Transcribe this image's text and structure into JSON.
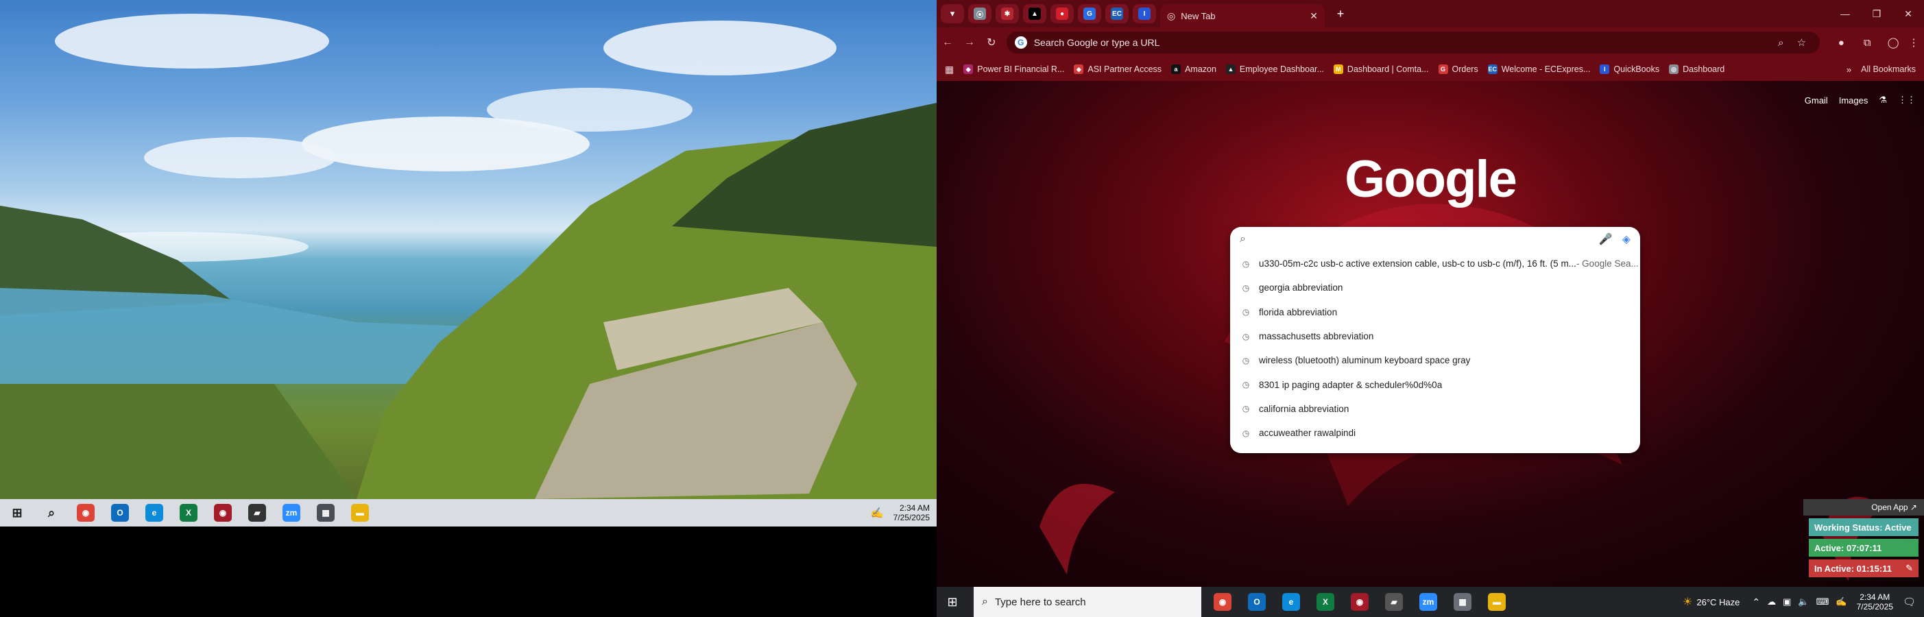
{
  "left": {
    "taskbar": {
      "apps": [
        {
          "name": "start",
          "glyph": "⊞",
          "color": "#1f1f1f"
        },
        {
          "name": "search",
          "glyph": "⌕",
          "color": "#1f1f1f"
        },
        {
          "name": "chrome",
          "glyph": "◉",
          "color": "#db4437"
        },
        {
          "name": "outlook",
          "glyph": "O",
          "color": "#0f6cbd"
        },
        {
          "name": "edge",
          "glyph": "e",
          "color": "#0c8cd8"
        },
        {
          "name": "excel",
          "glyph": "X",
          "color": "#107c41"
        },
        {
          "name": "chrome-profile",
          "glyph": "◉",
          "color": "#a31b29"
        },
        {
          "name": "sticky-notes",
          "glyph": "▰",
          "color": "#333333"
        },
        {
          "name": "zoom",
          "glyph": "zm",
          "color": "#2d8cff"
        },
        {
          "name": "calculator",
          "glyph": "▦",
          "color": "#4a4f57"
        },
        {
          "name": "file-explorer",
          "glyph": "▬",
          "color": "#e8b20f"
        }
      ],
      "time": "2:34 AM",
      "date": "7/25/2025"
    }
  },
  "right": {
    "tabs": {
      "pinned": [
        {
          "name": "tab-1",
          "glyph": "⦿",
          "color": "#7d8a96"
        },
        {
          "name": "tab-2",
          "glyph": "✱",
          "color": "#b3262f"
        },
        {
          "name": "tab-3",
          "glyph": "▲",
          "color": "#000000"
        },
        {
          "name": "tab-4",
          "glyph": "●",
          "color": "#d31f2b"
        },
        {
          "name": "tab-5",
          "glyph": "G",
          "color": "#2a6de3"
        },
        {
          "name": "tab-6",
          "glyph": "EC",
          "color": "#1f5fb8"
        },
        {
          "name": "tab-7",
          "glyph": "I",
          "color": "#2757d6"
        }
      ],
      "active_title": "New Tab"
    },
    "omnibox": {
      "placeholder": "Search Google or type a URL"
    },
    "bookmarks": [
      {
        "label": "Power BI Financial R...",
        "color": "#a8276b",
        "glyph": "◆"
      },
      {
        "label": "ASI Partner Access",
        "color": "#d33a3a",
        "glyph": "◆"
      },
      {
        "label": "Amazon",
        "color": "#111111",
        "glyph": "a"
      },
      {
        "label": "Employee Dashboar...",
        "color": "#222222",
        "glyph": "▲"
      },
      {
        "label": "Dashboard | Comta...",
        "color": "#f2b200",
        "glyph": "M"
      },
      {
        "label": "Orders",
        "color": "#d23a3a",
        "glyph": "G"
      },
      {
        "label": "Welcome - ECExpres...",
        "color": "#1f5fb8",
        "glyph": "EC"
      },
      {
        "label": "QuickBooks",
        "color": "#2757d6",
        "glyph": "I"
      },
      {
        "label": "Dashboard",
        "color": "#8b8f95",
        "glyph": "◎"
      }
    ],
    "all_bookmarks": "All Bookmarks",
    "ntp": {
      "gmail": "Gmail",
      "images": "Images",
      "logo": "Google",
      "suggestions": [
        {
          "text": "u330-05m-c2c usb-c active extension cable, usb-c to usb-c (m/f), 16 ft. (5 m...",
          "suffix": " - Google Sea..."
        },
        {
          "text": "georgia abbreviation",
          "suffix": ""
        },
        {
          "text": "florida abbreviation",
          "suffix": ""
        },
        {
          "text": "massachusetts abbreviation",
          "suffix": ""
        },
        {
          "text": "wireless (bluetooth) aluminum keyboard space gray",
          "suffix": ""
        },
        {
          "text": "8301 ip paging adapter & scheduler%0d%0a",
          "suffix": ""
        },
        {
          "text": "california abbreviation",
          "suffix": ""
        },
        {
          "text": "accuweather rawalpindi",
          "suffix": ""
        }
      ]
    },
    "widget": {
      "open_app": "Open App ↗",
      "working": "Working Status: Active",
      "active": "Active: 07:07:11",
      "inactive": "In Active: 01:15:11",
      "working_color": "#4aa79e",
      "active_color": "#3aa55a",
      "inactive_color": "#c63a3a"
    },
    "taskbar": {
      "search_placeholder": "Type here to search",
      "apps": [
        {
          "name": "chrome",
          "glyph": "◉",
          "color": "#db4437"
        },
        {
          "name": "outlook",
          "glyph": "O",
          "color": "#0f6cbd"
        },
        {
          "name": "edge",
          "glyph": "e",
          "color": "#0c8cd8"
        },
        {
          "name": "excel",
          "glyph": "X",
          "color": "#107c41"
        },
        {
          "name": "chrome-profile",
          "glyph": "◉",
          "color": "#a31b29"
        },
        {
          "name": "sticky-notes",
          "glyph": "▰",
          "color": "#555555"
        },
        {
          "name": "zoom",
          "glyph": "zm",
          "color": "#2d8cff"
        },
        {
          "name": "calculator",
          "glyph": "▦",
          "color": "#6a6f77"
        },
        {
          "name": "file-explorer",
          "glyph": "▬",
          "color": "#e8b20f"
        }
      ],
      "weather": "26°C  Haze",
      "time": "2:34 AM",
      "date": "7/25/2025"
    }
  }
}
